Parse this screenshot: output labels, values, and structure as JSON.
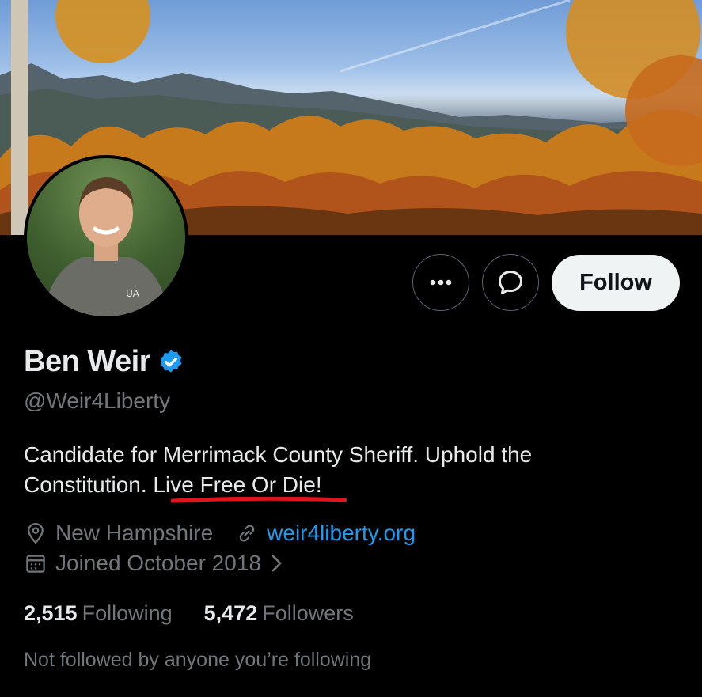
{
  "profile": {
    "name": "Ben Weir",
    "handle": "@Weir4Liberty",
    "bio_part1": "Candidate for Merrimack County Sheriff. Uphold the Constitution. ",
    "bio_highlight": "Live Free Or Die!",
    "location": "New Hampshire",
    "website": "weir4liberty.org",
    "joined": "Joined October 2018"
  },
  "actions": {
    "more_icon": "more-horizontal-icon",
    "message_icon": "message-bubble-icon",
    "follow_label": "Follow"
  },
  "stats": {
    "following_count": "2,515",
    "following_label": "Following",
    "followers_count": "5,472",
    "followers_label": "Followers"
  },
  "followed_by": "Not followed by anyone you’re following",
  "colors": {
    "background": "#000000",
    "text": "#e7e9ea",
    "secondary_text": "#71767b",
    "link": "#1d9bf0",
    "verified": "#1d9bf0",
    "highlight_underline": "#e0141e"
  }
}
